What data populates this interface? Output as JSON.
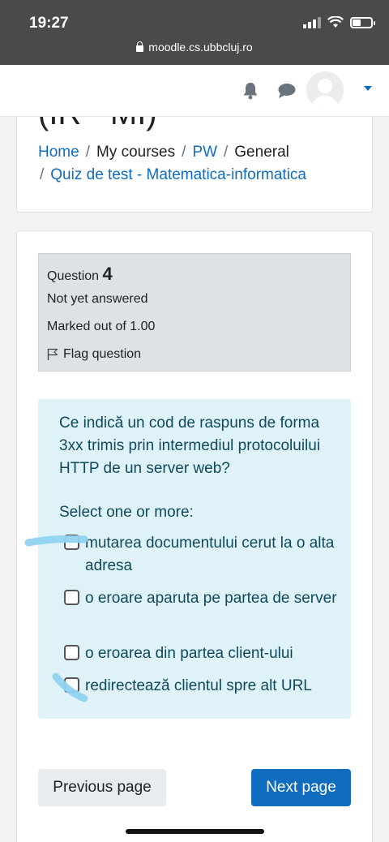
{
  "status_bar": {
    "time": "19:27",
    "url": "moodle.cs.ubbcluj.ro"
  },
  "page_heading_partial": "(IR - MI)",
  "breadcrumb": {
    "home": "Home",
    "my_courses": "My courses",
    "course": "PW",
    "section": "General",
    "quiz": "Quiz de test - Matematica-informatica",
    "separator": "/"
  },
  "question_info": {
    "label": "Question",
    "number": "4",
    "state": "Not yet answered",
    "grade": "Marked out of 1.00",
    "flag_label": "Flag question"
  },
  "question": {
    "text": "Ce indică un cod de raspuns de forma 3xx trimis prin intermediul protocoluilui HTTP de un server web?",
    "prompt": "Select one or more:",
    "options": [
      {
        "label": "mutarea documentului cerut la o alta adresa",
        "checked": false
      },
      {
        "label": "o eroare aparuta pe partea de server",
        "checked": false
      },
      {
        "label": "o eroarea din partea client-ului",
        "checked": false
      },
      {
        "label": "redirectează clientul spre alt URL",
        "checked": false
      }
    ]
  },
  "navigation": {
    "previous": "Previous page",
    "next": "Next page"
  },
  "colors": {
    "link": "#0f6cbf",
    "info_bg": "#dee2e6",
    "content_bg": "#def2f8",
    "highlight": "#8fd3f0"
  }
}
